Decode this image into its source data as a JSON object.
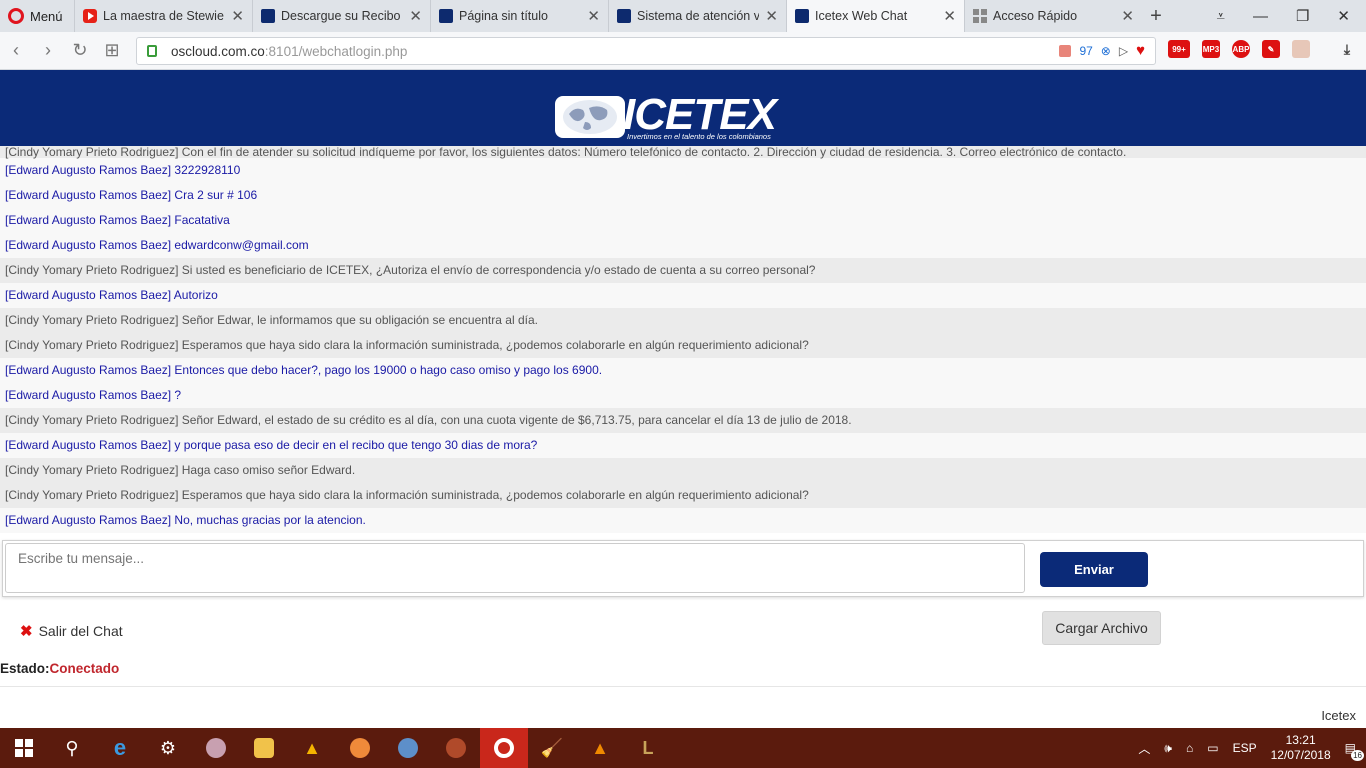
{
  "browser": {
    "menu_label": "Menú",
    "tabs": [
      {
        "title": "La maestra de Stewie (F",
        "icon": "youtube-icon"
      },
      {
        "title": "Descargue su Recibo",
        "icon": "icetex-favicon"
      },
      {
        "title": "Página sin título",
        "icon": "icetex-favicon"
      },
      {
        "title": "Sistema de atención vir",
        "icon": "icetex-favicon"
      },
      {
        "title": "Icetex Web Chat",
        "icon": "icetex-favicon",
        "active": true
      },
      {
        "title": "Acceso Rápido",
        "icon": "speed-dial-icon"
      }
    ],
    "url_host": "oscloud.com.co",
    "url_rest": ":8101/webchatlogin.php",
    "url_badge_count": "97",
    "ext_badge": "99+",
    "ext_mp3": "MP3",
    "ext_abp": "ABP"
  },
  "logo": {
    "text": "ICETEX",
    "tagline": "Invertimos en el talento de los colombianos"
  },
  "chat": {
    "messages": [
      {
        "role": "agent",
        "text": "[Cindy Yomary Prieto Rodriguez] Con el fin de atender su solicitud indíqueme por favor, los siguientes datos: Número telefónico de contacto. 2. Dirección y ciudad de residencia. 3. Correo electrónico de contacto."
      },
      {
        "role": "user",
        "text": "[Edward Augusto Ramos Baez] 3222928110"
      },
      {
        "role": "user",
        "text": "[Edward Augusto Ramos Baez] Cra 2 sur # 106"
      },
      {
        "role": "user",
        "text": "[Edward Augusto Ramos Baez] Facatativa"
      },
      {
        "role": "user",
        "text": "[Edward Augusto Ramos Baez] edwardconw@gmail.com"
      },
      {
        "role": "agent",
        "text": "[Cindy Yomary Prieto Rodriguez] Si usted es beneficiario de ICETEX, ¿Autoriza el envío de correspondencia y/o estado de cuenta a su correo personal?"
      },
      {
        "role": "user",
        "text": "[Edward Augusto Ramos Baez] Autorizo"
      },
      {
        "role": "agent",
        "text": "[Cindy Yomary Prieto Rodriguez] Señor Edwar, le informamos que su obligación se encuentra al día."
      },
      {
        "role": "agent",
        "text": "[Cindy Yomary Prieto Rodriguez] Esperamos que haya sido clara la información suministrada, ¿podemos colaborarle en algún requerimiento adicional?"
      },
      {
        "role": "user",
        "text": "[Edward Augusto Ramos Baez] Entonces que debo hacer?, pago los 19000 o hago caso omiso y pago los 6900."
      },
      {
        "role": "user",
        "text": "[Edward Augusto Ramos Baez] ?"
      },
      {
        "role": "agent",
        "text": "[Cindy Yomary Prieto Rodriguez] Señor Edward, el estado de su crédito es al día, con una cuota vigente de $6,713.75, para cancelar el día 13 de julio de 2018."
      },
      {
        "role": "user",
        "text": "[Edward Augusto Ramos Baez] y porque pasa eso de decir en el recibo que tengo 30 dias de mora?"
      },
      {
        "role": "agent",
        "text": "[Cindy Yomary Prieto Rodriguez] Haga caso omiso señor Edward."
      },
      {
        "role": "agent",
        "text": "[Cindy Yomary Prieto Rodriguez] Esperamos que haya sido clara la información suministrada, ¿podemos colaborarle en algún requerimiento adicional?"
      },
      {
        "role": "user",
        "text": "[Edward Augusto Ramos Baez] No, muchas gracias por la atencion."
      }
    ]
  },
  "composer": {
    "placeholder": "Escribe tu mensaje...",
    "send_label": "Enviar",
    "exit_label": "Salir del Chat",
    "upload_label": "Cargar Archivo"
  },
  "status": {
    "label": "Estado:",
    "value": "Conectado"
  },
  "footer": {
    "brand": "Icetex"
  },
  "taskbar": {
    "language": "ESP",
    "time": "13:21",
    "date": "12/07/2018",
    "notifications": "16"
  },
  "colors": {
    "header_bg": "#0b2a78",
    "user_text": "#1a1aa6",
    "agent_text": "#555555",
    "status_connected": "#c0262d"
  }
}
